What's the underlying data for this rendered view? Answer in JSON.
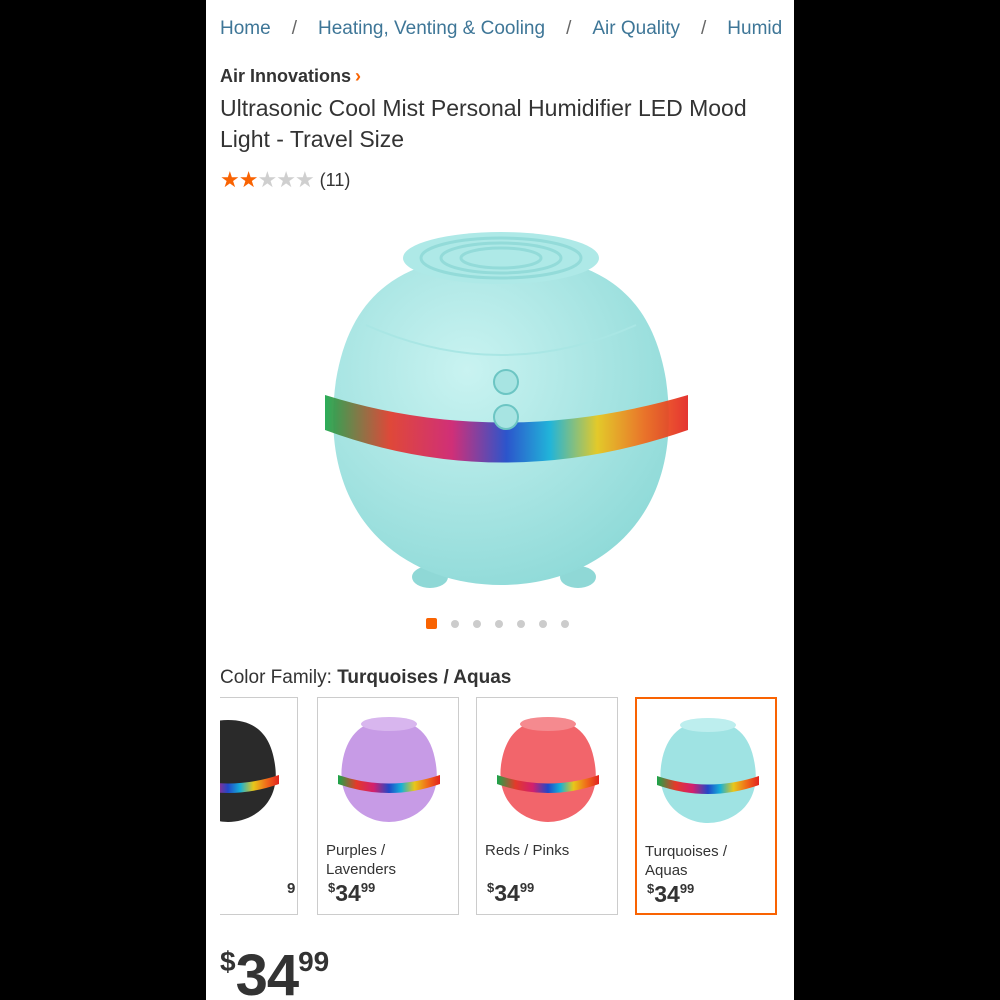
{
  "breadcrumb": {
    "items": [
      "Home",
      "Heating, Venting & Cooling",
      "Air Quality",
      "Humid"
    ],
    "separator": "/"
  },
  "product": {
    "brand": "Air Innovations",
    "title": "Ultrasonic Cool Mist Personal Humidifier LED Mood Light - Travel Size",
    "rating": {
      "value": 2,
      "max": 5,
      "count": "(11)"
    },
    "image_count": 7,
    "active_image": 1
  },
  "color_family": {
    "label": "Color Family:",
    "selected": "Turquoises / Aquas"
  },
  "swatches": [
    {
      "name": "",
      "price_cur": "",
      "price_dollars": "9",
      "price_cents": "",
      "color": "#2a2a2a",
      "selected": false
    },
    {
      "name": "Purples / Lavenders",
      "price_cur": "$",
      "price_dollars": "34",
      "price_cents": "99",
      "color": "#c79be6",
      "selected": false
    },
    {
      "name": "Reds / Pinks",
      "price_cur": "$",
      "price_dollars": "34",
      "price_cents": "99",
      "color": "#f2656b",
      "selected": false
    },
    {
      "name": "Turquoises / Aquas",
      "price_cur": "$",
      "price_dollars": "34",
      "price_cents": "99",
      "color": "#9fe3e3",
      "selected": true
    }
  ],
  "price": {
    "currency": "$",
    "dollars": "34",
    "cents": "99"
  },
  "colors": {
    "accent": "#f96302",
    "link": "#3e7697",
    "product": "#9fe3e3"
  }
}
